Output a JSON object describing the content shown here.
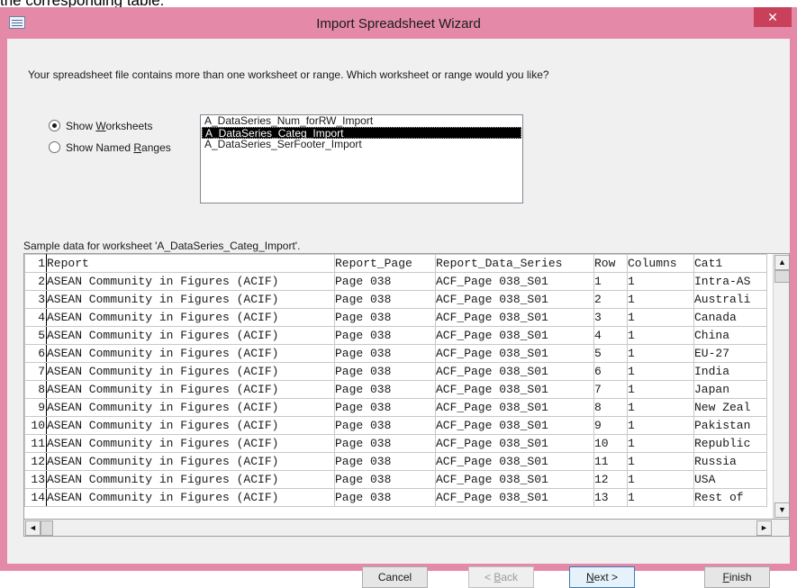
{
  "above_text": "the corresponding table.",
  "window": {
    "title": "Import Spreadsheet Wizard",
    "close_glyph": "✕"
  },
  "instruction": "Your spreadsheet file contains more than one worksheet or range. Which worksheet or range would you like?",
  "radios": [
    {
      "label": "Show Worksheets",
      "access_key": "W",
      "checked": true
    },
    {
      "label": "Show Named Ranges",
      "access_key": "R",
      "checked": false
    }
  ],
  "worksheets": [
    {
      "name": "A_DataSeries_Num_forRW_Import",
      "selected": false
    },
    {
      "name": "A_DataSeries_Categ_Import",
      "selected": true
    },
    {
      "name": "A_DataSeries_SerFooter_Import",
      "selected": false
    }
  ],
  "sample_label": "Sample data for worksheet 'A_DataSeries_Categ_Import'.",
  "grid": {
    "rows": [
      [
        "1",
        "Report",
        "Report_Page",
        "Report_Data_Series",
        "Row",
        "Columns",
        "Cat1"
      ],
      [
        "2",
        "ASEAN Community in Figures (ACIF)",
        "Page 038",
        "ACF_Page 038_S01",
        "1",
        "1",
        "Intra-AS"
      ],
      [
        "3",
        "ASEAN Community in Figures (ACIF)",
        "Page 038",
        "ACF_Page 038_S01",
        "2",
        "1",
        "Australi"
      ],
      [
        "4",
        "ASEAN Community in Figures (ACIF)",
        "Page 038",
        "ACF_Page 038_S01",
        "3",
        "1",
        "Canada"
      ],
      [
        "5",
        "ASEAN Community in Figures (ACIF)",
        "Page 038",
        "ACF_Page 038_S01",
        "4",
        "1",
        "China"
      ],
      [
        "6",
        "ASEAN Community in Figures (ACIF)",
        "Page 038",
        "ACF_Page 038_S01",
        "5",
        "1",
        "EU-27"
      ],
      [
        "7",
        "ASEAN Community in Figures (ACIF)",
        "Page 038",
        "ACF_Page 038_S01",
        "6",
        "1",
        "India"
      ],
      [
        "8",
        "ASEAN Community in Figures (ACIF)",
        "Page 038",
        "ACF_Page 038_S01",
        "7",
        "1",
        "Japan"
      ],
      [
        "9",
        "ASEAN Community in Figures (ACIF)",
        "Page 038",
        "ACF_Page 038_S01",
        "8",
        "1",
        "New Zeal"
      ],
      [
        "10",
        "ASEAN Community in Figures (ACIF)",
        "Page 038",
        "ACF_Page 038_S01",
        "9",
        "1",
        "Pakistan"
      ],
      [
        "11",
        "ASEAN Community in Figures (ACIF)",
        "Page 038",
        "ACF_Page 038_S01",
        "10",
        "1",
        "Republic"
      ],
      [
        "12",
        "ASEAN Community in Figures (ACIF)",
        "Page 038",
        "ACF_Page 038_S01",
        "11",
        "1",
        "Russia"
      ],
      [
        "13",
        "ASEAN Community in Figures (ACIF)",
        "Page 038",
        "ACF_Page 038_S01",
        "12",
        "1",
        "USA"
      ],
      [
        "14",
        "ASEAN Community in Figures (ACIF)",
        "Page 038",
        "ACF_Page 038_S01",
        "13",
        "1",
        "Rest of"
      ]
    ]
  },
  "scroll_glyphs": {
    "up": "▲",
    "down": "▼",
    "left": "◄",
    "right": "►"
  },
  "buttons": {
    "cancel": {
      "label": "Cancel"
    },
    "back": {
      "pre": "< ",
      "key": "B",
      "post": "ack",
      "enabled": false
    },
    "next": {
      "pre": "",
      "key": "N",
      "post": "ext >",
      "enabled": true
    },
    "finish": {
      "pre": "",
      "key": "F",
      "post": "inish",
      "enabled": true
    }
  },
  "colors": {
    "title_bar": "#e48aa8",
    "close_button": "#c9405a",
    "selection": "#000000"
  }
}
